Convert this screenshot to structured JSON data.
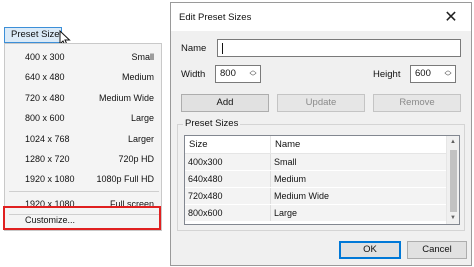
{
  "dropdown": {
    "button_label": "Preset Size",
    "items": [
      {
        "size": "400 x 300",
        "name": "Small"
      },
      {
        "size": "640 x 480",
        "name": "Medium"
      },
      {
        "size": "720 x 480",
        "name": "Medium Wide"
      },
      {
        "size": "800 x 600",
        "name": "Large"
      },
      {
        "size": "1024 x 768",
        "name": "Larger"
      },
      {
        "size": "1280 x 720",
        "name": "720p HD"
      },
      {
        "size": "1920 x 1080",
        "name": "1080p Full HD"
      },
      {
        "size": "1920 x 1080",
        "name": "Full screen"
      }
    ],
    "customize_label": "Customize..."
  },
  "dialog": {
    "title": "Edit Preset Sizes",
    "close_glyph": "✕",
    "name_label": "Name",
    "name_value": "",
    "width_label": "Width",
    "width_value": "800",
    "height_label": "Height",
    "height_value": "600",
    "add_label": "Add",
    "update_label": "Update",
    "remove_label": "Remove",
    "group_title": "Preset Sizes",
    "columns": [
      "Size",
      "Name"
    ],
    "rows": [
      [
        "400x300",
        "Small"
      ],
      [
        "640x480",
        "Medium"
      ],
      [
        "720x480",
        "Medium Wide"
      ],
      [
        "800x600",
        "Large"
      ]
    ],
    "ok_label": "OK",
    "cancel_label": "Cancel"
  },
  "colors": {
    "highlight_border": "#e02020",
    "button_focus": "#0078d7",
    "dropdown_button_bg": "#dbeaf7"
  }
}
